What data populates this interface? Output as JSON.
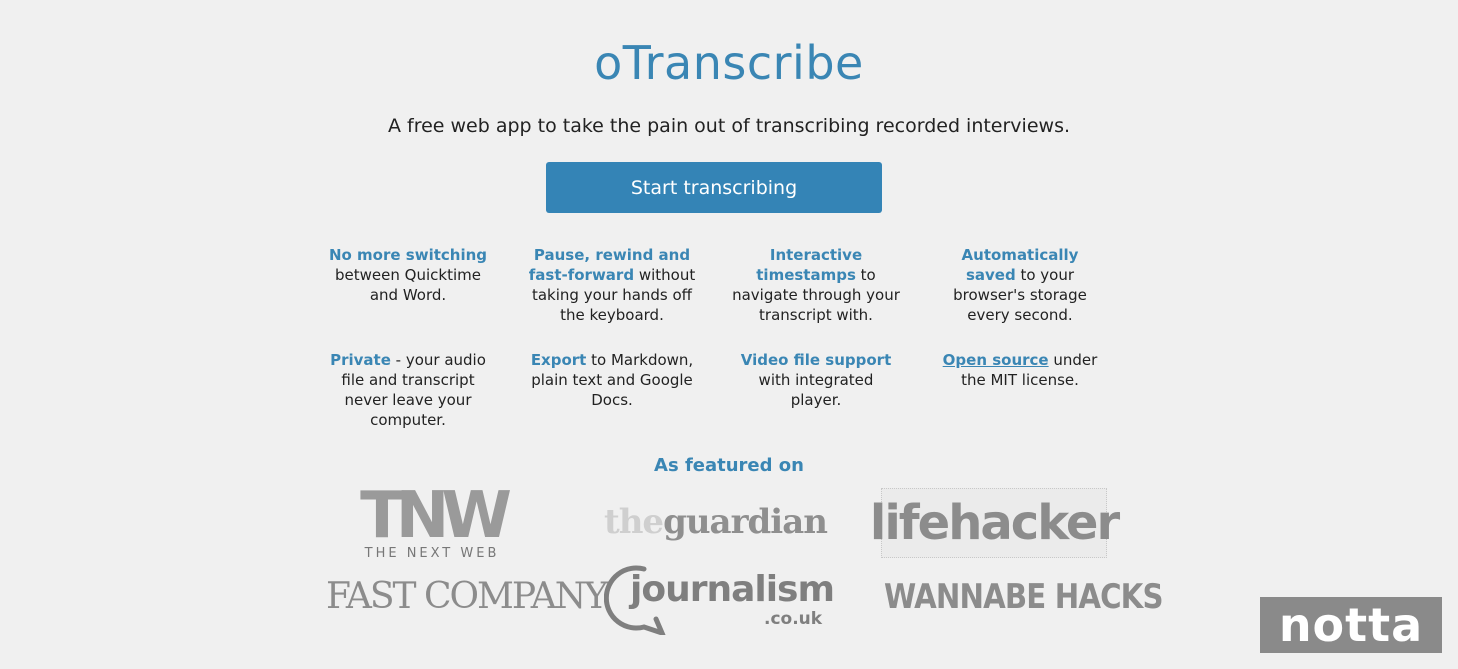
{
  "header": {
    "title": "oTranscribe",
    "subtitle": "A free web app to take the pain out of transcribing recorded interviews."
  },
  "start_button": {
    "label": "Start transcribing"
  },
  "features": [
    {
      "highlight": "No more switching",
      "text": " between Quicktime and Word."
    },
    {
      "highlight": "Pause, rewind and fast-forward",
      "text": " without taking your hands off the keyboard."
    },
    {
      "highlight": "Interactive timestamps",
      "text": " to navigate through your transcript with."
    },
    {
      "highlight": "Automatically saved",
      "text": " to your browser's storage every second."
    },
    {
      "highlight": "Private",
      "text": " - your audio file and transcript never leave your computer."
    },
    {
      "highlight": "Export",
      "text": " to Markdown, plain text and Google Docs."
    },
    {
      "highlight": "Video file support",
      "text": " with integrated player."
    },
    {
      "highlight": "Open source",
      "text": " under the MIT license."
    }
  ],
  "featured": {
    "heading": "As featured on",
    "logos": {
      "tnw_big": "TNW",
      "tnw_small": "THE NEXT WEB",
      "guardian_the": "the",
      "guardian_name": "guardian",
      "lifehacker": "lifehacker",
      "fastcompany": "FAST COMPANY",
      "journalism": "journalism",
      "journalism_sub": ".co.uk",
      "wannabe": "WANNABE HACKS"
    }
  },
  "watermark": {
    "text": "notta"
  }
}
